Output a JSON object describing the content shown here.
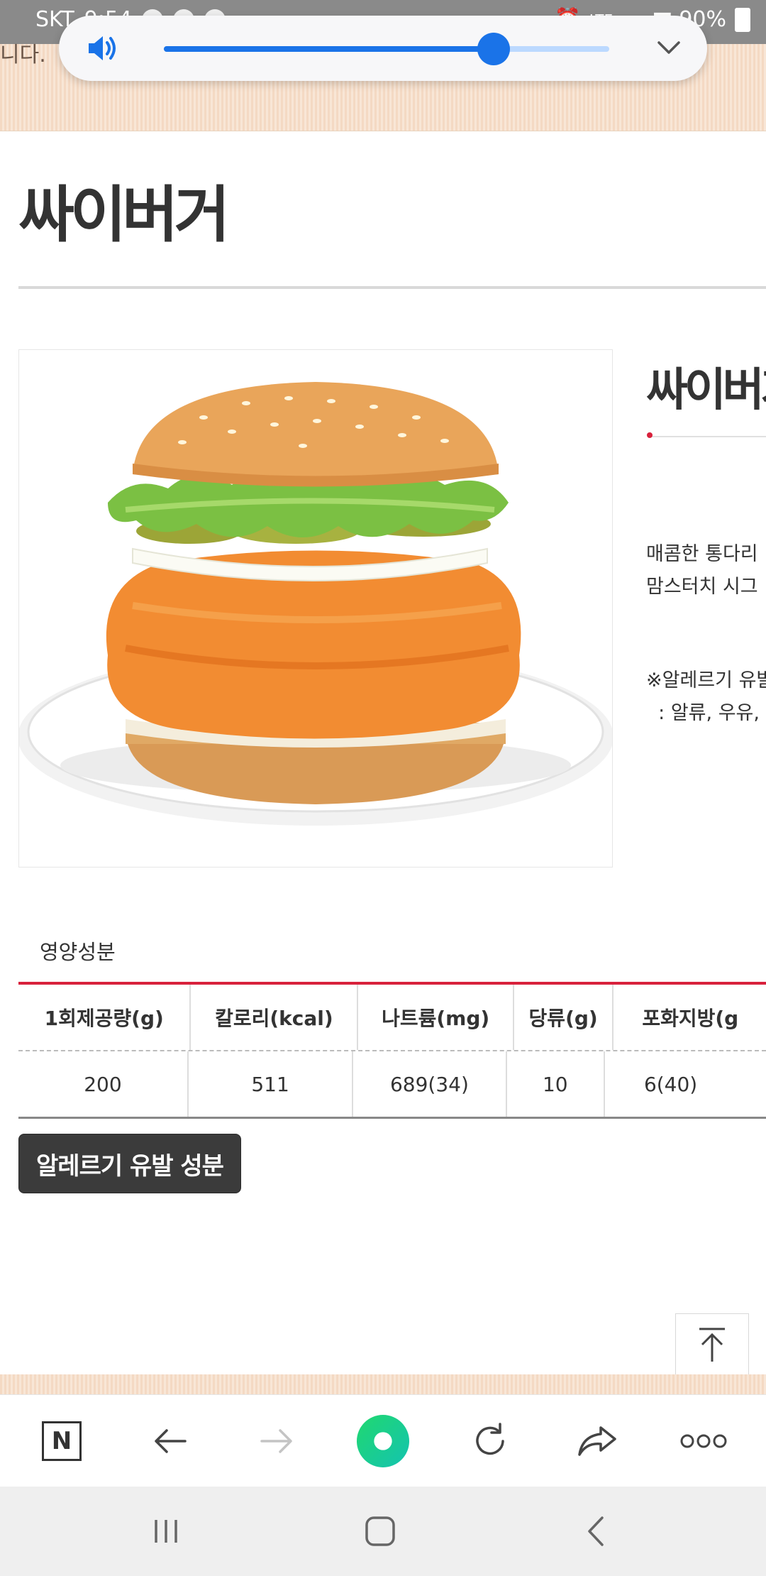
{
  "status_bar": {
    "carrier": "SKT",
    "time": "9:54",
    "network": "LTE",
    "battery": "90%"
  },
  "banner": {
    "fragment": "니다."
  },
  "volume": {
    "level_percent": 74
  },
  "product": {
    "title": "싸이버거",
    "side_title": "싸이버거",
    "description_lines": [
      "매콤한 통다리",
      "맘스터치 시그"
    ],
    "allergy_lines": [
      "※알레르기 유발",
      "  : 알류, 우유, "
    ]
  },
  "nutrition": {
    "title": "영양성분",
    "headers": [
      "1회제공량(g)",
      "칼로리(kcal)",
      "나트륨(mg)",
      "당류(g)",
      "포화지방(g"
    ],
    "values": [
      "200",
      "511",
      "689(34)",
      "10",
      "6(40)"
    ]
  },
  "allergy_button": {
    "label": "알레르기 유발 성분"
  },
  "icons": {
    "volume": "speaker-icon",
    "collapse": "chevron-down-icon",
    "to_top": "arrow-up-icon",
    "naver": "naver-n-icon",
    "back": "arrow-left-icon",
    "forward": "arrow-right-icon",
    "green_dot": "green-dot-icon",
    "refresh": "refresh-icon",
    "share": "share-icon",
    "more": "more-icon",
    "recents": "recents-icon",
    "home": "home-icon",
    "sys_back": "back-icon"
  },
  "colors": {
    "accent_red": "#d8213c",
    "volume_blue": "#1a73e8",
    "green_button": "#1ec86a",
    "button_dark": "#3b3b3b"
  },
  "toolbar": {
    "naver_label": "N"
  }
}
